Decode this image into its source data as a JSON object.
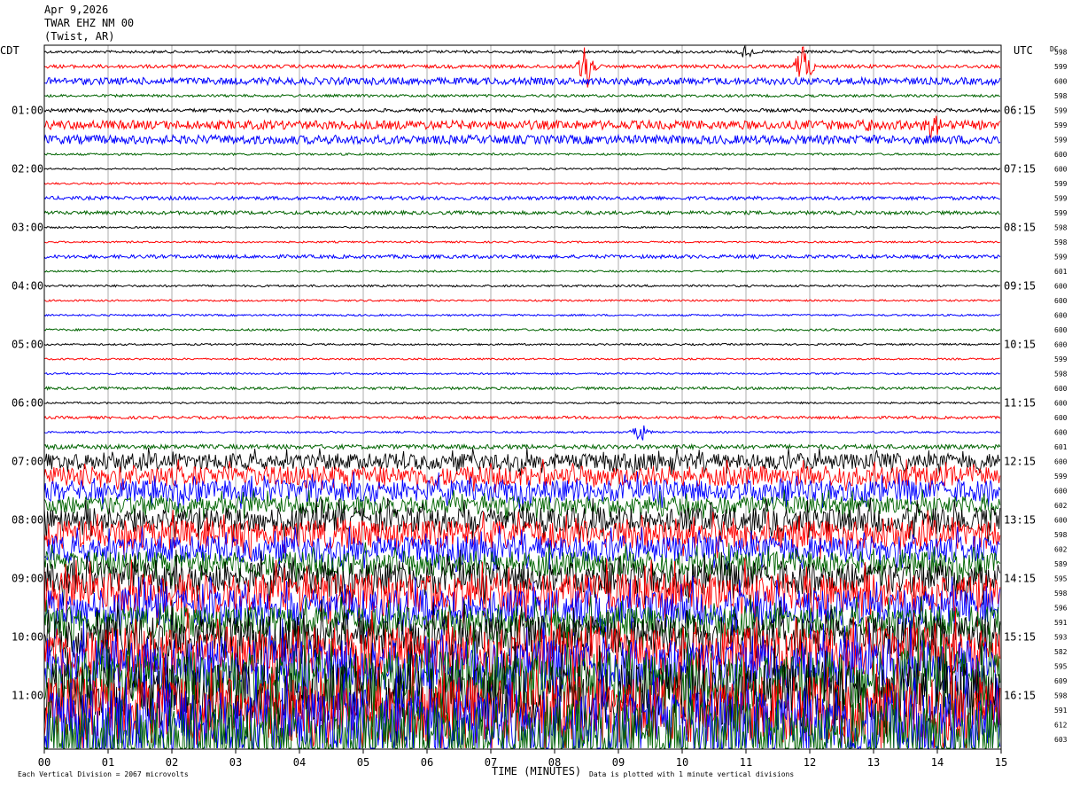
{
  "header": {
    "date": "Apr 9,2026",
    "station": "TWAR EHZ NM 00",
    "location": "(Twist, AR)"
  },
  "labels": {
    "left_tz": "CDT",
    "right_tz": "UTC",
    "dc_header": "DC",
    "xlabel": "TIME (MINUTES)",
    "footer_left": "Each Vertical Division = 2067 microvolts",
    "footer_right": "Data is plotted with 1 minute vertical divisions"
  },
  "chart_data": {
    "type": "line",
    "title": "TWAR EHZ NM 00",
    "xlabel": "TIME (MINUTES)",
    "x_ticks": [
      "00",
      "01",
      "02",
      "03",
      "04",
      "05",
      "06",
      "07",
      "08",
      "09",
      "10",
      "11",
      "12",
      "13",
      "14",
      "15"
    ],
    "xlim": [
      0,
      15
    ],
    "left_time_labels": [
      "01:00",
      "02:00",
      "03:00",
      "04:00",
      "05:00",
      "06:00",
      "07:00",
      "08:00",
      "09:00",
      "10:00",
      "11:00"
    ],
    "right_time_labels": [
      "06:15",
      "07:15",
      "08:15",
      "09:15",
      "10:15",
      "11:15",
      "12:15",
      "13:15",
      "14:15",
      "15:15",
      "16:15"
    ],
    "trace_colors": [
      "#000000",
      "#ff0000",
      "#0000ff",
      "#006400"
    ],
    "dc_offsets": [
      598,
      599,
      600,
      598,
      599,
      599,
      599,
      600,
      600,
      599,
      599,
      599,
      598,
      598,
      599,
      601,
      600,
      600,
      600,
      600,
      600,
      599,
      598,
      600,
      600,
      600,
      600,
      601,
      600,
      599,
      600,
      602,
      600,
      598,
      602,
      589,
      595,
      598,
      596,
      591,
      593,
      582,
      595,
      609,
      598,
      591,
      612,
      603
    ],
    "amplitude_per_row": [
      1.5,
      2,
      4,
      1.5,
      2,
      5,
      5,
      1.2,
      1,
      1,
      2,
      2,
      1,
      1,
      2,
      1,
      1.2,
      1,
      1,
      1.2,
      1,
      1,
      1,
      1.5,
      1,
      1.5,
      1,
      2.5,
      9,
      11,
      12,
      10,
      14,
      16,
      15,
      14,
      18,
      22,
      20,
      18,
      24,
      28,
      30,
      34,
      36,
      38,
      40,
      42
    ],
    "events": [
      {
        "row": 1,
        "minute": 8.5,
        "amplitude": 30
      },
      {
        "row": 0,
        "minute": 11.0,
        "amplitude": 8
      },
      {
        "row": 1,
        "minute": 11.9,
        "amplitude": 25
      },
      {
        "row": 5,
        "minute": 13.0,
        "amplitude": 10
      },
      {
        "row": 5,
        "minute": 13.9,
        "amplitude": 15
      },
      {
        "row": 26,
        "minute": 9.35,
        "amplitude": 12
      }
    ]
  }
}
